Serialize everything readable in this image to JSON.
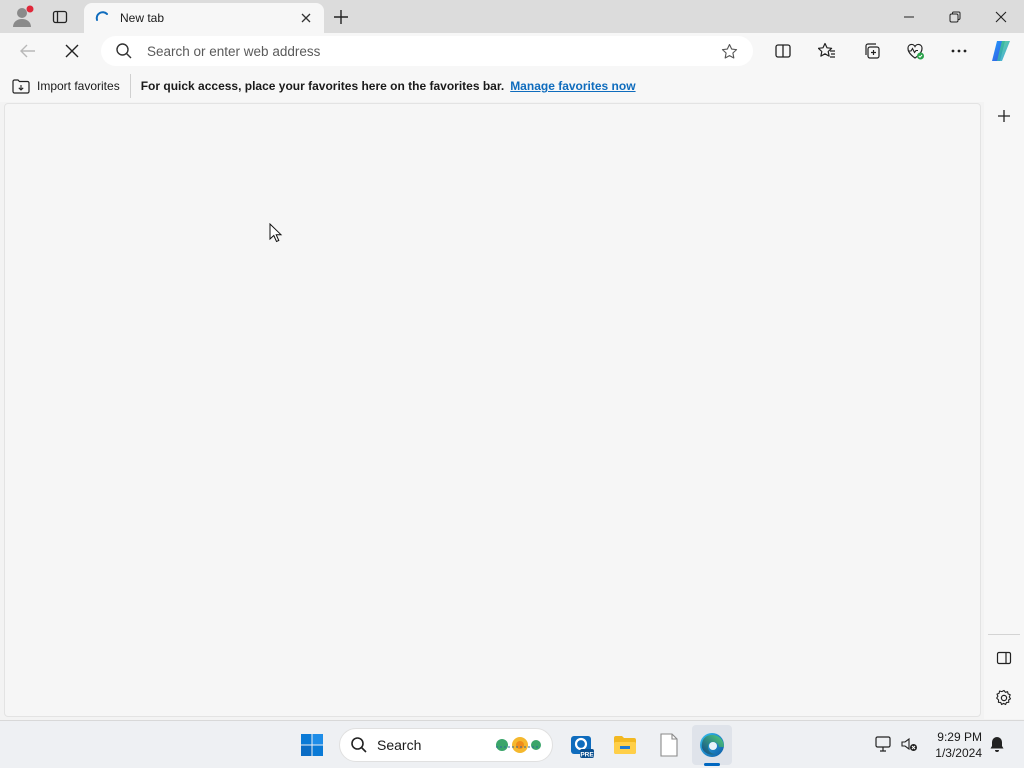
{
  "tab": {
    "title": "New tab"
  },
  "omnibox": {
    "placeholder": "Search or enter web address"
  },
  "favorites_bar": {
    "import_label": "Import favorites",
    "message": "For quick access, place your favorites here on the favorites bar.",
    "link": "Manage favorites now"
  },
  "taskbar": {
    "search_label": "Search",
    "time": "9:29 PM",
    "date": "1/3/2024",
    "outlook_badge": "PRE"
  },
  "colors": {
    "accent": "#0f6cbd",
    "edge_blue": "#0067c0",
    "profile_dot": "#e0283a"
  },
  "icons": [
    "profile-icon",
    "tab-actions-icon",
    "loading-spinner-icon",
    "close-icon",
    "plus-icon",
    "minimize-icon",
    "restore-icon",
    "back-icon",
    "stop-icon",
    "search-icon",
    "star-icon",
    "split-screen-icon",
    "favorites-icon",
    "collections-icon",
    "performance-icon",
    "more-icon",
    "copilot-icon",
    "import-icon",
    "sidebar-add-icon",
    "hide-sidebar-icon",
    "settings-icon",
    "windows-start-icon",
    "outlook-icon",
    "file-explorer-icon",
    "notepad-icon",
    "edge-icon",
    "network-icon",
    "volume-muted-icon",
    "bell-icon"
  ]
}
